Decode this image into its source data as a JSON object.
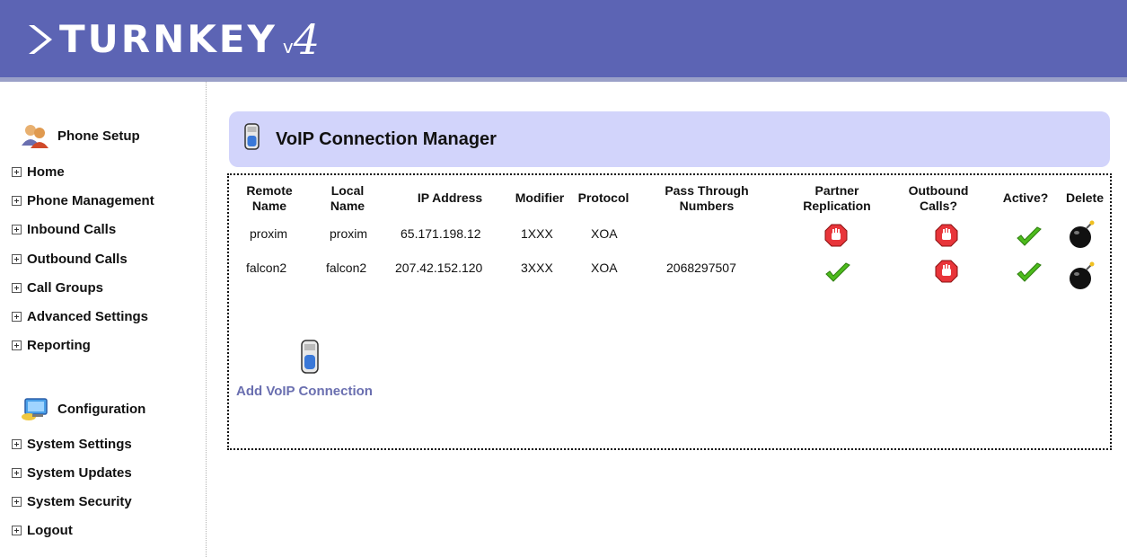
{
  "brand": {
    "name": "TURNKEY",
    "version_prefix": "v",
    "version_num": "4"
  },
  "colors": {
    "topbar": "#5c64b4",
    "header_panel": "#d2d4fb",
    "link": "#6a6fb0",
    "stop": "#e8353a",
    "check": "#4dbb1d"
  },
  "sidebar": {
    "phone_setup": {
      "title": "Phone Setup",
      "icon": "users-icon",
      "items": [
        "Home",
        "Phone Management",
        "Inbound Calls",
        "Outbound Calls",
        "Call Groups",
        "Advanced Settings",
        "Reporting"
      ]
    },
    "configuration": {
      "title": "Configuration",
      "icon": "config-monitor-icon",
      "items": [
        "System Settings",
        "System Updates",
        "System Security",
        "Logout"
      ]
    }
  },
  "page": {
    "title": "VoIP Connection Manager",
    "icon": "voip-phone-icon"
  },
  "table": {
    "headers": {
      "remote_name": [
        "Remote",
        "Name"
      ],
      "local_name": [
        "Local",
        "Name"
      ],
      "ip": "IP Address",
      "modifier": "Modifier",
      "protocol": "Protocol",
      "pass_through": [
        "Pass Through",
        "Numbers"
      ],
      "partner_replication": [
        "Partner",
        "Replication"
      ],
      "outbound": [
        "Outbound",
        "Calls?"
      ],
      "active": "Active?",
      "delete": "Delete"
    },
    "rows": [
      {
        "remote_name": "proxim",
        "local_name": "proxim",
        "ip": "65.171.198.12",
        "modifier": "1XXX",
        "protocol": "XOA",
        "pass_through": "",
        "partner_replication": "no",
        "outbound": "no",
        "active": "yes"
      },
      {
        "remote_name": "falcon2",
        "local_name": "falcon2",
        "ip": "207.42.152.120",
        "modifier": "3XXX",
        "protocol": "XOA",
        "pass_through": "2068297507",
        "partner_replication": "yes",
        "outbound": "no",
        "active": "yes"
      }
    ]
  },
  "actions": {
    "add_label": "Add VoIP Connection",
    "add_icon": "voip-phone-icon"
  }
}
